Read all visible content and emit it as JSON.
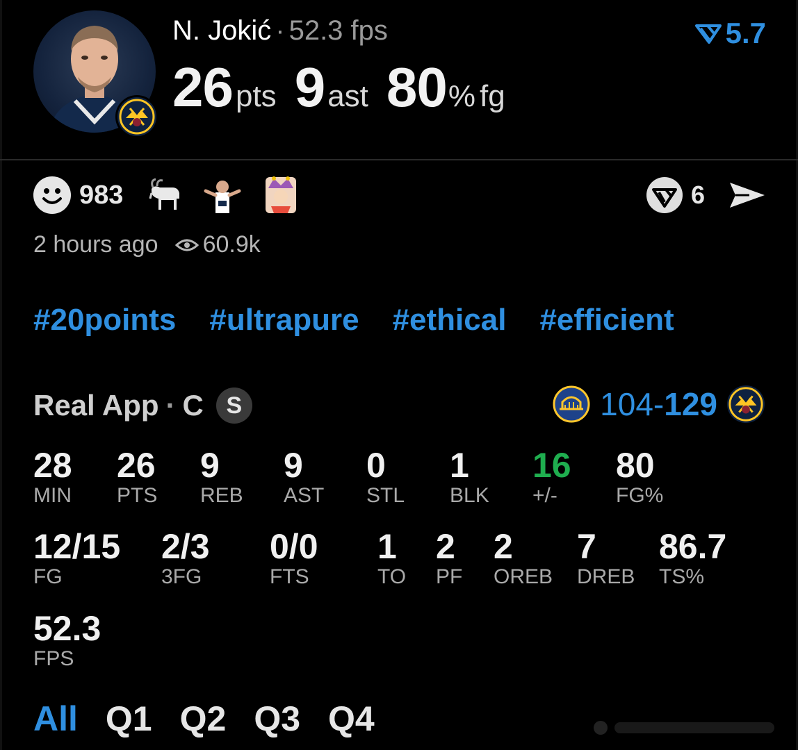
{
  "header": {
    "player_name": "N. Jokić",
    "separator": "·",
    "fps_text": "52.3 fps",
    "points": "26",
    "points_unit": "pts",
    "assists": "9",
    "assists_unit": "ast",
    "fg_pct": "80",
    "fg_pct_symbol": "%",
    "fg_unit": "fg",
    "rating": "5.7",
    "rating_icon": "real-logo-icon",
    "team_badge_icon": "nuggets-logo-icon"
  },
  "reactions": {
    "count": "983",
    "emojis": [
      "goat-emoji",
      "player-shrug-emoji",
      "jester-emoji"
    ],
    "share_count": "6",
    "send_icon": "send-icon"
  },
  "meta": {
    "time_ago": "2 hours ago",
    "views": "60.9k"
  },
  "hashtags": [
    "#20points",
    "#ultrapure",
    "#ethical",
    "#efficient"
  ],
  "source": {
    "app": "Real App",
    "position": "C",
    "badge": "S"
  },
  "game": {
    "away_score": "104",
    "dash": "-",
    "home_score": "129",
    "away_logo": "warriors-logo-icon",
    "home_logo": "nuggets-logo-icon"
  },
  "stats_row1": [
    {
      "label": "MIN",
      "value": "28"
    },
    {
      "label": "PTS",
      "value": "26"
    },
    {
      "label": "REB",
      "value": "9"
    },
    {
      "label": "AST",
      "value": "9"
    },
    {
      "label": "STL",
      "value": "0"
    },
    {
      "label": "BLK",
      "value": "1"
    },
    {
      "label": "+/-",
      "value": "16"
    },
    {
      "label": "FG%",
      "value": "80"
    }
  ],
  "stats_row2": [
    {
      "label": "FG",
      "value": "12/15"
    },
    {
      "label": "3FG",
      "value": "2/3"
    },
    {
      "label": "FTS",
      "value": "0/0"
    },
    {
      "label": "TO",
      "value": "1"
    },
    {
      "label": "PF",
      "value": "2"
    },
    {
      "label": "OREB",
      "value": "2"
    },
    {
      "label": "DREB",
      "value": "7"
    },
    {
      "label": "TS%",
      "value": "86.7"
    }
  ],
  "stats_row3": [
    {
      "label": "FPS",
      "value": "52.3"
    }
  ],
  "tabs": [
    "All",
    "Q1",
    "Q2",
    "Q3",
    "Q4"
  ],
  "colors": {
    "accent": "#2f8fe0",
    "positive": "#1fae4f",
    "background": "#000000"
  }
}
